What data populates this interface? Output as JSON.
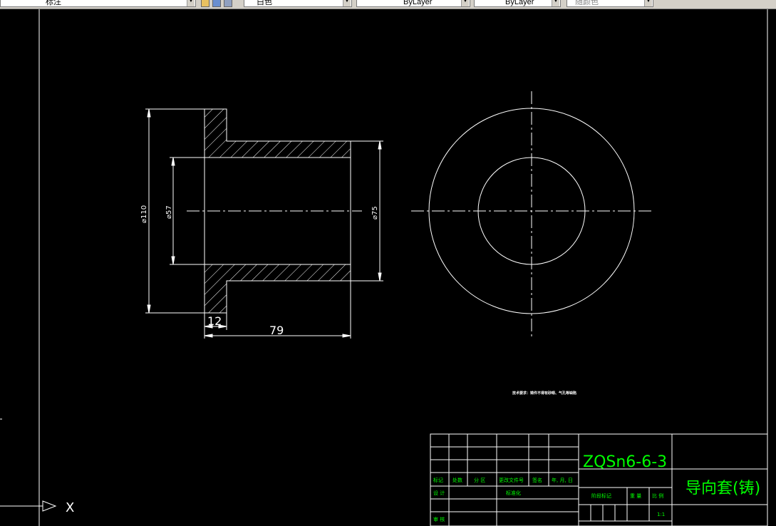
{
  "toolbar": {
    "layer_value": "标注",
    "color_value": "白色",
    "linetype_value": "ByLayer",
    "lineweight_value": "ByLayer",
    "plotstyle_value": "随颜色"
  },
  "drawing": {
    "dim_overall_dia": "⌀110",
    "dim_bore_dia": "⌀57",
    "dim_body_dia": "⌀75",
    "dim_flange_thk": "12",
    "dim_length": "79",
    "note_text": "技术要求：铸件不得有砂眼、气孔等缺陷"
  },
  "title_block": {
    "material": "ZQSn6-6-3",
    "part_name": "导向套(铸)",
    "hdr_mark": "标记",
    "hdr_count": "处数",
    "hdr_zone": "分 区",
    "hdr_docno": "更改文件号",
    "hdr_sign": "签名",
    "hdr_date": "年, 月, 日",
    "hdr_design": "设 计",
    "hdr_std": "标准化",
    "hdr_review": "审 核",
    "hdr_stage": "阶段标记",
    "hdr_weight": "重 量",
    "hdr_scale": "比 例",
    "scale_value": "1:1"
  },
  "ucs": {
    "x_label": "X"
  },
  "colors": {
    "background": "#000000",
    "lines": "#ffffff",
    "title_block": "#00ff00"
  }
}
